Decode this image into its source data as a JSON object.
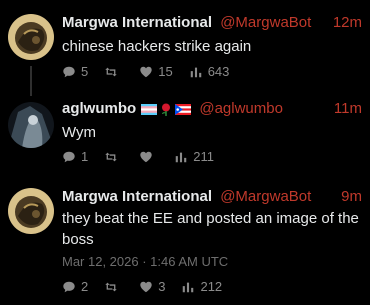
{
  "thread": {
    "tweets": [
      {
        "display_name": "Margwa International",
        "handle": "@MargwaBot",
        "time": "12m",
        "text": "chinese hackers strike again",
        "replies": "5",
        "retweets": "",
        "likes": "15",
        "views": "643"
      },
      {
        "display_name": "aglwumbo",
        "handle": "@aglwumbo",
        "time": "11m",
        "text": "Wym",
        "replies": "1",
        "retweets": "",
        "likes": "",
        "views": "211"
      },
      {
        "display_name": "Margwa International",
        "handle": "@MargwaBot",
        "time": "9m",
        "text": "they beat the EE and posted an image of the boss",
        "timestamp": "Mar 12, 2026 · 1:46 AM UTC",
        "replies": "2",
        "retweets": "",
        "likes": "3",
        "views": "212"
      }
    ]
  },
  "colors": {
    "background": "#000000",
    "accent": "#c0392b",
    "text": "#e7e9ea",
    "muted": "#8b8b8b"
  },
  "icons": {
    "reply": "speech-bubble-icon",
    "retweet": "retweet-icon",
    "like": "heart-icon",
    "views": "bar-chart-icon",
    "flags": [
      "transgender-flag-icon",
      "rose-icon",
      "puerto-rico-flag-icon"
    ]
  }
}
